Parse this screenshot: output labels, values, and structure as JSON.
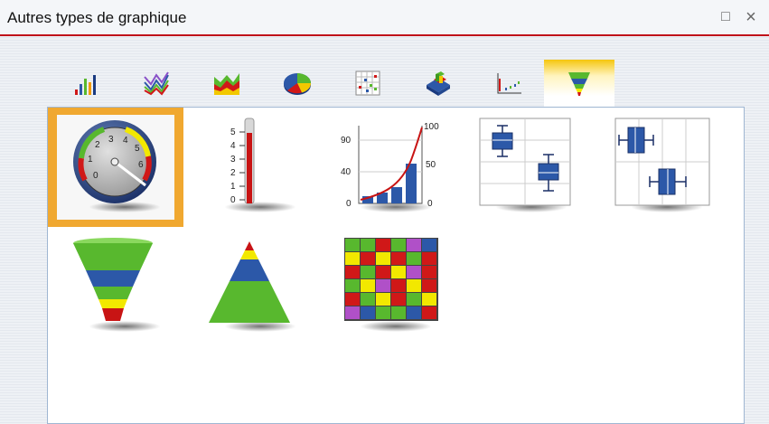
{
  "window": {
    "title": "Autres types de graphique",
    "restore_glyph": "□",
    "close_glyph": "×"
  },
  "tabs": [
    {
      "icon": "bar-chart-icon",
      "active": false
    },
    {
      "icon": "line-chart-icon",
      "active": false
    },
    {
      "icon": "area-chart-icon",
      "active": false
    },
    {
      "icon": "pie-chart-icon",
      "active": false
    },
    {
      "icon": "scatter-chart-icon",
      "active": false
    },
    {
      "icon": "3d-bar-chart-icon",
      "active": false
    },
    {
      "icon": "xy-chart-icon",
      "active": false
    },
    {
      "icon": "funnel-chart-icon",
      "active": true
    }
  ],
  "gauge": {
    "ticks": [
      "0",
      "1",
      "2",
      "3",
      "4",
      "5",
      "6"
    ]
  },
  "thermometer": {
    "ticks": [
      "5",
      "4",
      "3",
      "2",
      "1",
      "0"
    ]
  },
  "pareto": {
    "left_ticks": [
      "90",
      "40",
      "0"
    ],
    "right_ticks": [
      "100",
      "50",
      "0"
    ]
  },
  "colors": {
    "accent": "#c0111a",
    "selection": "#f0a830",
    "tab_active": "#f5c60d",
    "green": "#58b82e",
    "blue": "#2c58a8",
    "yellow": "#f2e800",
    "red": "#d01818",
    "purple": "#b050c8"
  },
  "chart_types": [
    {
      "icon": "gauge-icon",
      "selected": true
    },
    {
      "icon": "thermometer-icon",
      "selected": false
    },
    {
      "icon": "pareto-chart-icon",
      "selected": false
    },
    {
      "icon": "box-plot-vertical-icon",
      "selected": false
    },
    {
      "icon": "box-plot-horizontal-icon",
      "selected": false
    },
    {
      "icon": "funnel-icon",
      "selected": false
    },
    {
      "icon": "pyramid-icon",
      "selected": false
    },
    {
      "icon": "heatmap-icon",
      "selected": false
    }
  ]
}
